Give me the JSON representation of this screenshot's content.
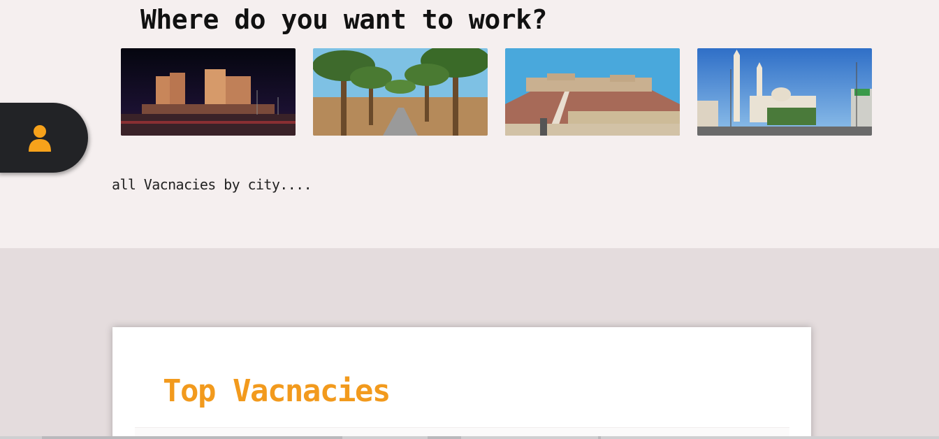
{
  "header": {
    "title": "Where do you want to work?"
  },
  "cities": [
    {
      "icon": "city-night-skyline-photo"
    },
    {
      "icon": "palm-tree-street-photo"
    },
    {
      "icon": "desert-castle-photo"
    },
    {
      "icon": "mosque-minarets-photo"
    }
  ],
  "side_tab": {
    "icon": "user-icon",
    "icon_color": "#f7a21b",
    "background": "#222326"
  },
  "links": {
    "all_by_city": "all Vacnacies by city...."
  },
  "vacancies": {
    "title": "Top Vacnacies",
    "title_color": "#f29a1d"
  },
  "colors": {
    "top_background": "#f5efef",
    "page_background": "#e4dcdd",
    "accent": "#f7a21b"
  }
}
